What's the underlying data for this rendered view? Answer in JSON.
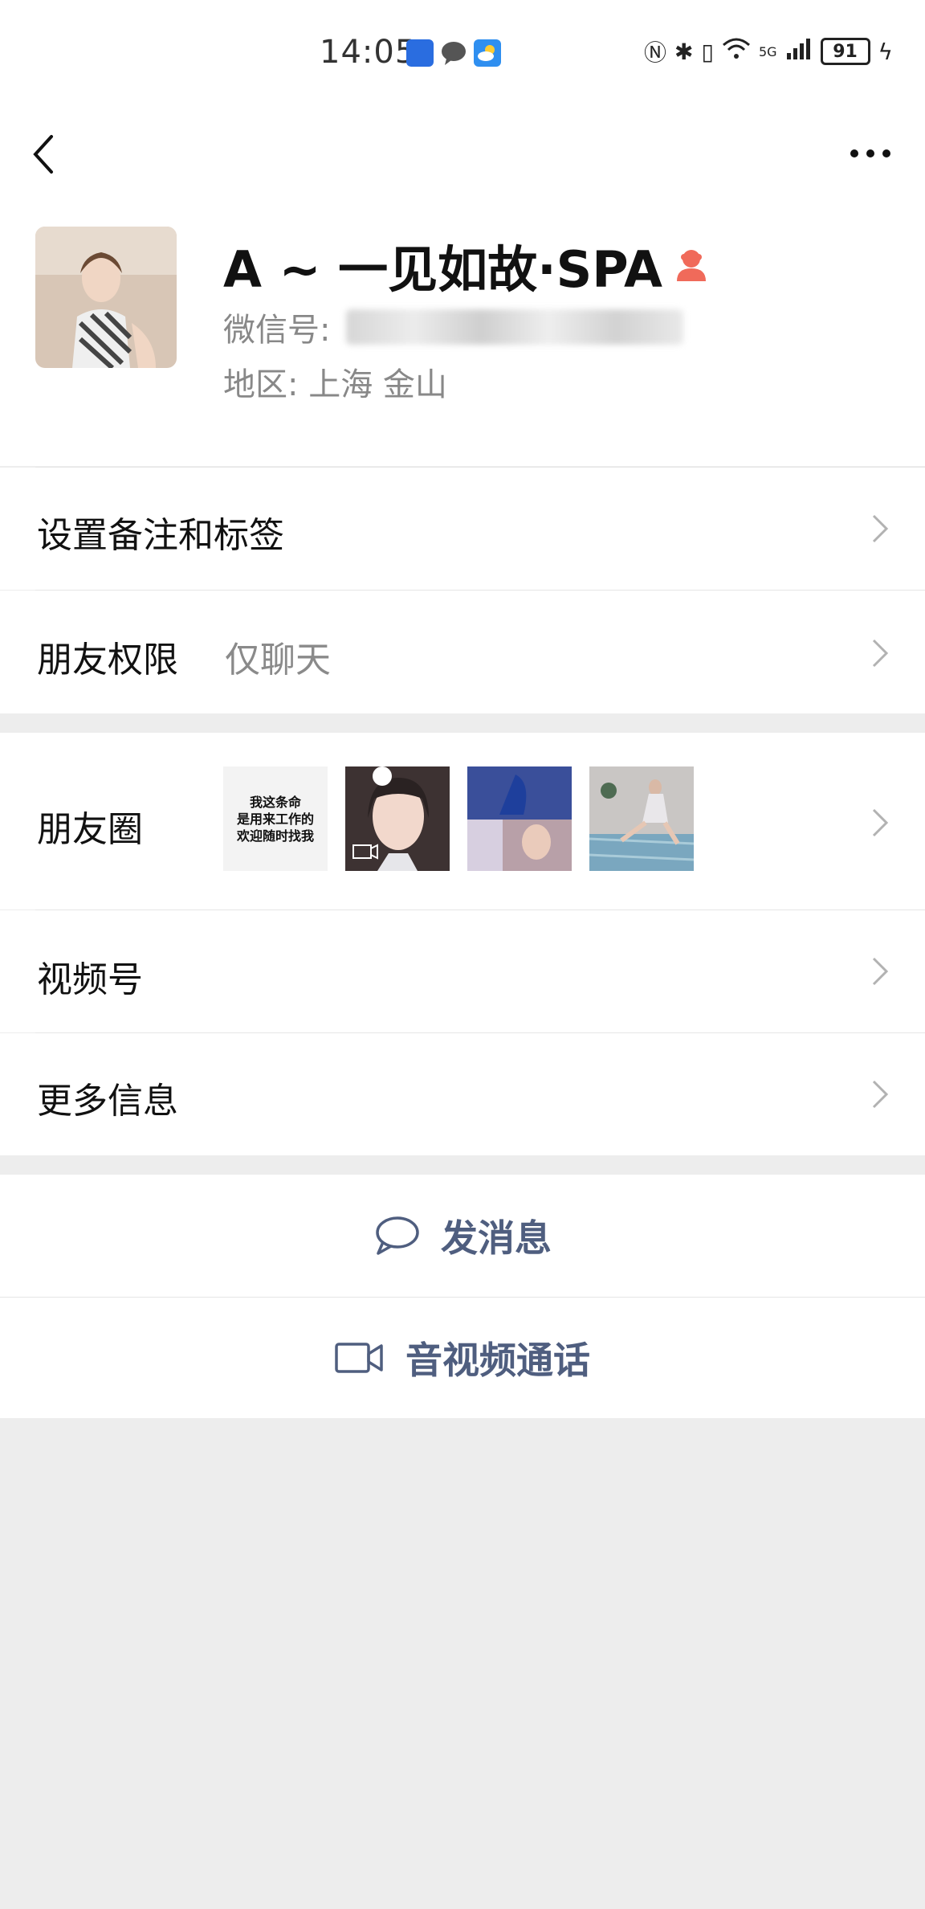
{
  "status_bar": {
    "time": "14:05",
    "battery": "91",
    "network": "5G"
  },
  "nav": {
    "back_icon": "chevron-left-icon",
    "more_icon": "more-horizontal-icon"
  },
  "profile": {
    "name": "A ~ 一见如故·SPA",
    "wechat_id_label": "微信号:",
    "region": "地区:  上海  金山"
  },
  "rows": {
    "remark": {
      "label": "设置备注和标签"
    },
    "permission": {
      "label": "朋友权限",
      "value": "仅聊天"
    },
    "moments": {
      "label": "朋友圈",
      "thumb1_text": "我这条命\n是用来工作的\n欢迎随时找我"
    },
    "channels": {
      "label": "视频号"
    },
    "more_info": {
      "label": "更多信息"
    }
  },
  "actions": {
    "message": "发消息",
    "call": "音视频通话"
  },
  "colors": {
    "accent_link": "#4f5e7f",
    "background": "#ededed",
    "gender_icon": "#f06a5a"
  }
}
